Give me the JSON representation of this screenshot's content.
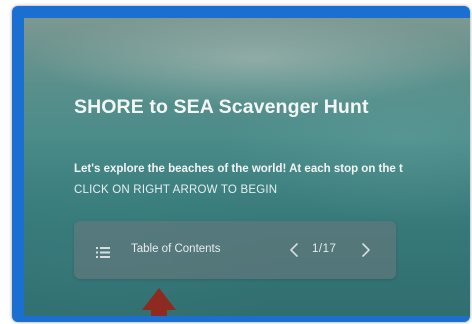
{
  "slide": {
    "title": "SHORE to SEA Scavenger Hunt",
    "subtitle": "Let's explore the beaches of the world! At each stop on the t",
    "instruction": "CLICK ON RIGHT ARROW TO BEGIN"
  },
  "toc_bar": {
    "label": "Table of Contents",
    "page_indicator": "1/17",
    "menu_icon": "list-icon",
    "prev_icon": "chevron-left-icon",
    "next_icon": "chevron-right-icon"
  },
  "colors": {
    "frame_border": "#1a6fd1",
    "pointer_arrow": "#8e2a1f",
    "text": "#f4f6f6"
  }
}
